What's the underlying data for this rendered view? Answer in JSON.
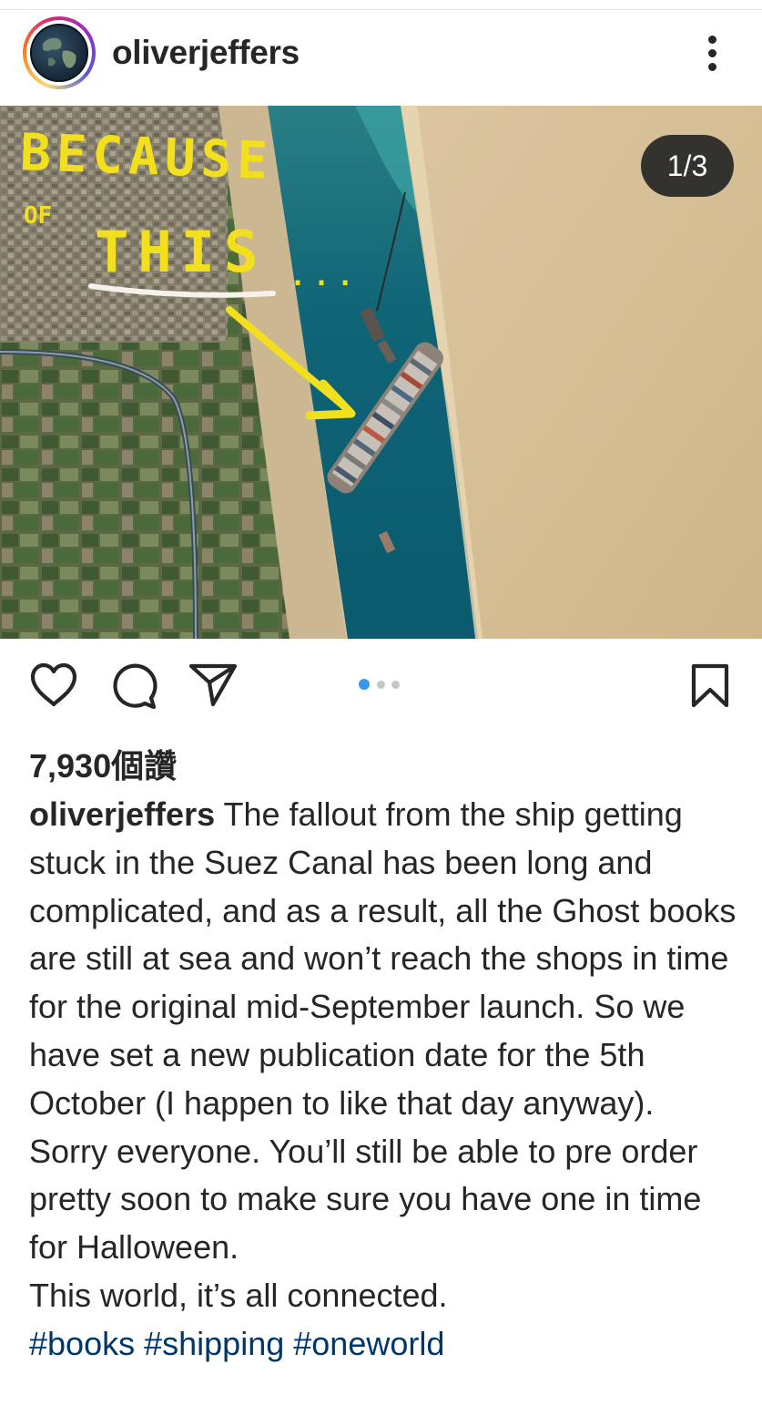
{
  "post": {
    "username": "oliverjeffers",
    "image_counter": "1/3",
    "image_overlay_text": {
      "line1": "BECAUSE",
      "line2_small": "OF",
      "line2": "THIS",
      "ellipsis": "..."
    },
    "carousel": {
      "total": 3,
      "active": 1,
      "active_color": "#3897f0",
      "inactive_color": "#c7c7c7"
    },
    "likes": "7,930個讚",
    "caption_user": "oliverjeffers",
    "caption_lines": [
      "The fallout from the ship getting stuck in the Suez Canal has been long and complicated, and as a result, all the Ghost books are still at sea and won’t reach the shops in time for the original mid-September launch. So we have set a new publication date for the 5th October (I happen to like that day anyway).",
      "Sorry everyone. You’ll still be able to pre order pretty soon to make sure you have one in time for Halloween.",
      "This world, it’s all connected."
    ],
    "hashtags": [
      "#books",
      "#shipping",
      "#oneworld"
    ]
  },
  "icons": {
    "more": "more-vertical-icon",
    "like": "heart-icon",
    "comment": "comment-icon",
    "share": "send-icon",
    "save": "bookmark-icon"
  },
  "colors": {
    "text": "#262626",
    "hashtag": "#00376b",
    "overlay_yellow": "#f2e01e",
    "canal_water": "#0e5f73"
  }
}
